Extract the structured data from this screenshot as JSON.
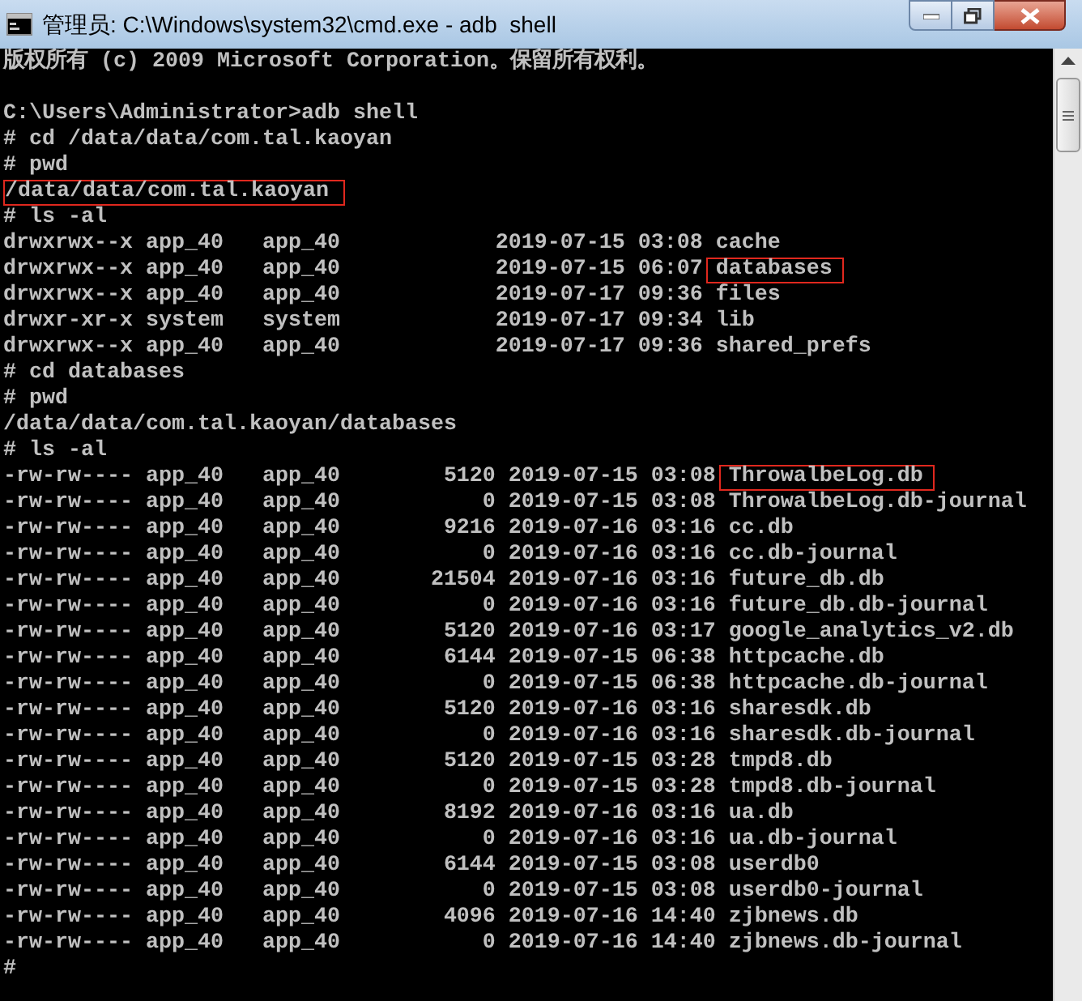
{
  "window": {
    "title": "管理员: C:\\Windows\\system32\\cmd.exe - adb  shell"
  },
  "lines": [
    {
      "kind": "text",
      "text": "版权所有 (c) 2009 Microsoft Corporation。保留所有权利。"
    },
    {
      "kind": "blank"
    },
    {
      "kind": "text",
      "text": "C:\\Users\\Administrator>adb shell"
    },
    {
      "kind": "text",
      "text": "# cd /data/data/com.tal.kaoyan"
    },
    {
      "kind": "text",
      "text": "# pwd"
    },
    {
      "kind": "text",
      "highlight": "/data/data/com.tal.kaoyan"
    },
    {
      "kind": "text",
      "text": "# ls -al"
    },
    {
      "kind": "text",
      "text": "drwxrwx--x app_40   app_40            2019-07-15 03:08 cache"
    },
    {
      "kind": "text",
      "text": "drwxrwx--x app_40   app_40            2019-07-15 06:07 ",
      "highlight": "databases"
    },
    {
      "kind": "text",
      "text": "drwxrwx--x app_40   app_40            2019-07-17 09:36 files"
    },
    {
      "kind": "text",
      "text": "drwxr-xr-x system   system            2019-07-17 09:34 lib"
    },
    {
      "kind": "text",
      "text": "drwxrwx--x app_40   app_40            2019-07-17 09:36 shared_prefs"
    },
    {
      "kind": "text",
      "text": "# cd databases"
    },
    {
      "kind": "text",
      "text": "# pwd"
    },
    {
      "kind": "text",
      "text": "/data/data/com.tal.kaoyan/databases"
    },
    {
      "kind": "text",
      "text": "# ls -al"
    },
    {
      "kind": "text",
      "text": "-rw-rw---- app_40   app_40        5120 2019-07-15 03:08 ",
      "highlight": "ThrowalbeLog.db"
    },
    {
      "kind": "text",
      "text": "-rw-rw---- app_40   app_40           0 2019-07-15 03:08 ThrowalbeLog.db-journal"
    },
    {
      "kind": "text",
      "text": "-rw-rw---- app_40   app_40        9216 2019-07-16 03:16 cc.db"
    },
    {
      "kind": "text",
      "text": "-rw-rw---- app_40   app_40           0 2019-07-16 03:16 cc.db-journal"
    },
    {
      "kind": "text",
      "text": "-rw-rw---- app_40   app_40       21504 2019-07-16 03:16 future_db.db"
    },
    {
      "kind": "text",
      "text": "-rw-rw---- app_40   app_40           0 2019-07-16 03:16 future_db.db-journal"
    },
    {
      "kind": "text",
      "text": "-rw-rw---- app_40   app_40        5120 2019-07-16 03:17 google_analytics_v2.db"
    },
    {
      "kind": "text",
      "text": "-rw-rw---- app_40   app_40        6144 2019-07-15 06:38 httpcache.db"
    },
    {
      "kind": "text",
      "text": "-rw-rw---- app_40   app_40           0 2019-07-15 06:38 httpcache.db-journal"
    },
    {
      "kind": "text",
      "text": "-rw-rw---- app_40   app_40        5120 2019-07-16 03:16 sharesdk.db"
    },
    {
      "kind": "text",
      "text": "-rw-rw---- app_40   app_40           0 2019-07-16 03:16 sharesdk.db-journal"
    },
    {
      "kind": "text",
      "text": "-rw-rw---- app_40   app_40        5120 2019-07-15 03:28 tmpd8.db"
    },
    {
      "kind": "text",
      "text": "-rw-rw---- app_40   app_40           0 2019-07-15 03:28 tmpd8.db-journal"
    },
    {
      "kind": "text",
      "text": "-rw-rw---- app_40   app_40        8192 2019-07-16 03:16 ua.db"
    },
    {
      "kind": "text",
      "text": "-rw-rw---- app_40   app_40           0 2019-07-16 03:16 ua.db-journal"
    },
    {
      "kind": "text",
      "text": "-rw-rw---- app_40   app_40        6144 2019-07-15 03:08 userdb0"
    },
    {
      "kind": "text",
      "text": "-rw-rw---- app_40   app_40           0 2019-07-15 03:08 userdb0-journal"
    },
    {
      "kind": "text",
      "text": "-rw-rw---- app_40   app_40        4096 2019-07-16 14:40 zjbnews.db"
    },
    {
      "kind": "text",
      "text": "-rw-rw---- app_40   app_40           0 2019-07-16 14:40 zjbnews.db-journal"
    },
    {
      "kind": "text",
      "text": "#"
    }
  ]
}
